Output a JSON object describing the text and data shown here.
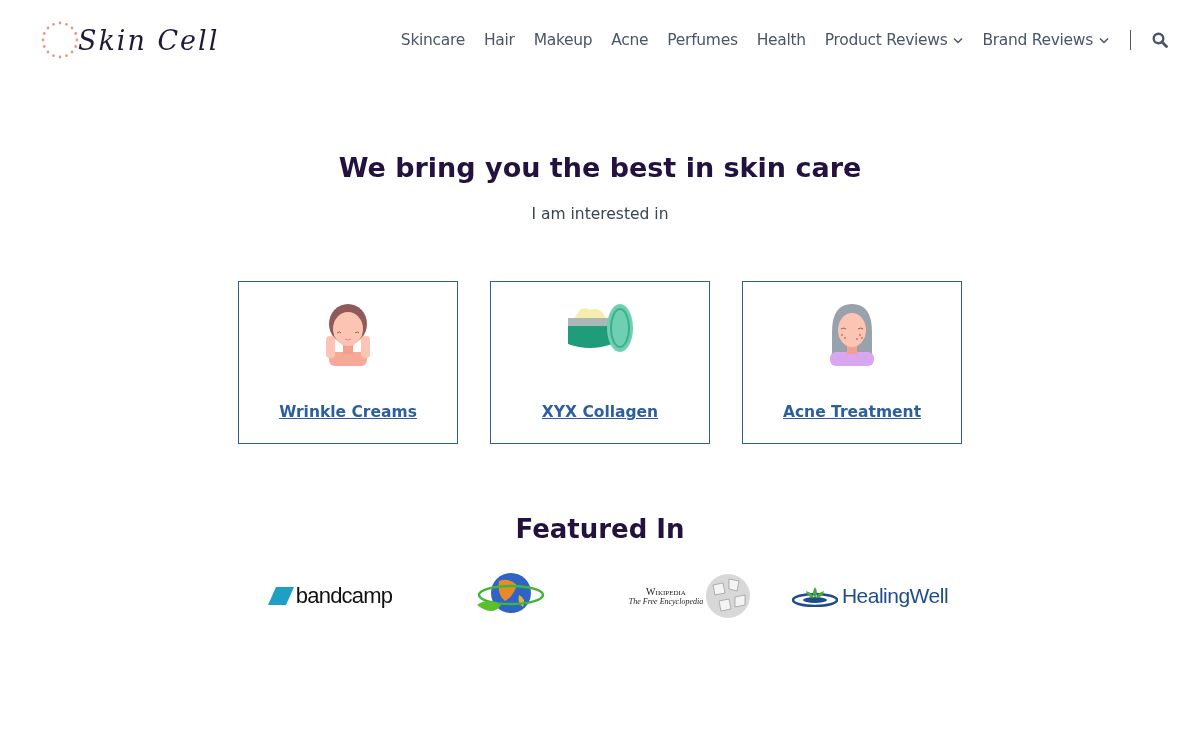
{
  "logo": {
    "text": "Skin Cell"
  },
  "nav": [
    {
      "label": "Skincare",
      "has_menu": false
    },
    {
      "label": "Hair",
      "has_menu": false
    },
    {
      "label": "Makeup",
      "has_menu": false
    },
    {
      "label": "Acne",
      "has_menu": false
    },
    {
      "label": "Perfumes",
      "has_menu": false
    },
    {
      "label": "Health",
      "has_menu": false
    },
    {
      "label": "Product Reviews",
      "has_menu": true
    },
    {
      "label": "Brand Reviews",
      "has_menu": true
    }
  ],
  "hero": {
    "title": "We bring you the best in skin care",
    "subtitle": "I am interested in"
  },
  "cards": [
    {
      "kind": "face",
      "label": "Wrinkle Creams"
    },
    {
      "kind": "jar",
      "label": "XYX Collagen"
    },
    {
      "kind": "acne",
      "label": "Acne Treatment"
    }
  ],
  "featured": {
    "title": "Featured In",
    "logos": [
      {
        "kind": "bandcamp",
        "text": "bandcamp"
      },
      {
        "kind": "globe"
      },
      {
        "kind": "wikipedia",
        "text": "Wikipedia",
        "tagline": "The Free Encyclopedia"
      },
      {
        "kind": "healingwell",
        "text": "HealingWell"
      }
    ]
  }
}
